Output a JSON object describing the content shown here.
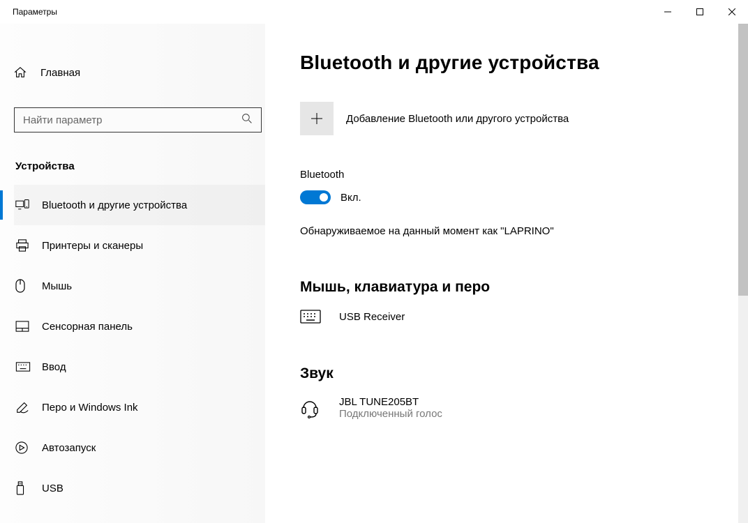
{
  "titlebar": {
    "title": "Параметры"
  },
  "sidebar": {
    "home_label": "Главная",
    "search_placeholder": "Найти параметр",
    "section_header": "Устройства",
    "items": [
      {
        "label": "Bluetooth и другие устройства",
        "active": true
      },
      {
        "label": "Принтеры и сканеры"
      },
      {
        "label": "Мышь"
      },
      {
        "label": "Сенсорная панель"
      },
      {
        "label": "Ввод"
      },
      {
        "label": "Перо и Windows Ink"
      },
      {
        "label": "Автозапуск"
      },
      {
        "label": "USB"
      }
    ]
  },
  "content": {
    "title": "Bluetooth и другие устройства",
    "add_device_label": "Добавление Bluetooth или другого устройства",
    "bt_label": "Bluetooth",
    "bt_toggle_state": "Вкл.",
    "discoverable_text": "Обнаруживаемое на данный момент как \"LAPRINO\"",
    "section_input": {
      "title": "Мышь, клавиатура и перо",
      "device_name": "USB Receiver"
    },
    "section_audio": {
      "title": "Звук",
      "device_name": "JBL TUNE205BT",
      "device_status": "Подключенный голос"
    }
  }
}
